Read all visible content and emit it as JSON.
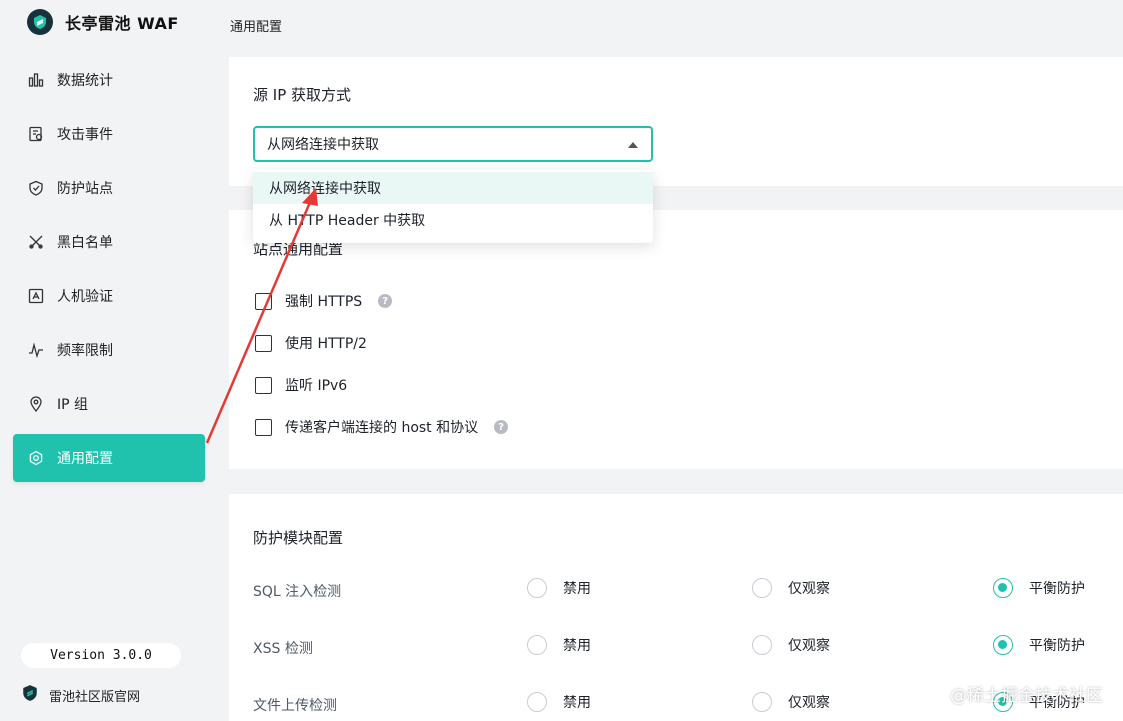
{
  "app": {
    "title": "长亭雷池 WAF"
  },
  "sidebar": {
    "items": [
      {
        "label": "数据统计",
        "icon": "bar-chart-icon"
      },
      {
        "label": "攻击事件",
        "icon": "event-list-icon"
      },
      {
        "label": "防护站点",
        "icon": "shield-icon"
      },
      {
        "label": "黑白名单",
        "icon": "tools-icon"
      },
      {
        "label": "人机验证",
        "icon": "captcha-icon"
      },
      {
        "label": "频率限制",
        "icon": "pulse-icon"
      },
      {
        "label": "IP 组",
        "icon": "location-icon"
      },
      {
        "label": "通用配置",
        "icon": "gear-icon",
        "active": true
      }
    ],
    "version": "Version 3.0.0",
    "official_site": "雷池社区版官网"
  },
  "breadcrumb": "通用配置",
  "source_ip": {
    "title": "源 IP 获取方式",
    "selected": "从网络连接中获取",
    "options": [
      "从网络连接中获取",
      "从 HTTP Header 中获取"
    ]
  },
  "site_config": {
    "title": "站点通用配置",
    "options": [
      {
        "label": "强制 HTTPS",
        "checked": false,
        "help": true
      },
      {
        "label": "使用 HTTP/2",
        "checked": false
      },
      {
        "label": "监听 IPv6",
        "checked": false
      },
      {
        "label": "传递客户端连接的 host 和协议",
        "checked": false,
        "help": true
      }
    ]
  },
  "modules": {
    "title": "防护模块配置",
    "mode_labels": {
      "disable": "禁用",
      "observe": "仅观察",
      "balance": "平衡防护"
    },
    "rows": [
      {
        "label": "SQL 注入检测",
        "selected": "balance"
      },
      {
        "label": "XSS 检测",
        "selected": "balance"
      },
      {
        "label": "文件上传检测",
        "selected": "balance"
      }
    ]
  },
  "watermark": "@稀土掘金技术社区",
  "colors": {
    "accent": "#20c2ad",
    "annotation": "#e53935",
    "page_bg": "#f2f3f5"
  }
}
